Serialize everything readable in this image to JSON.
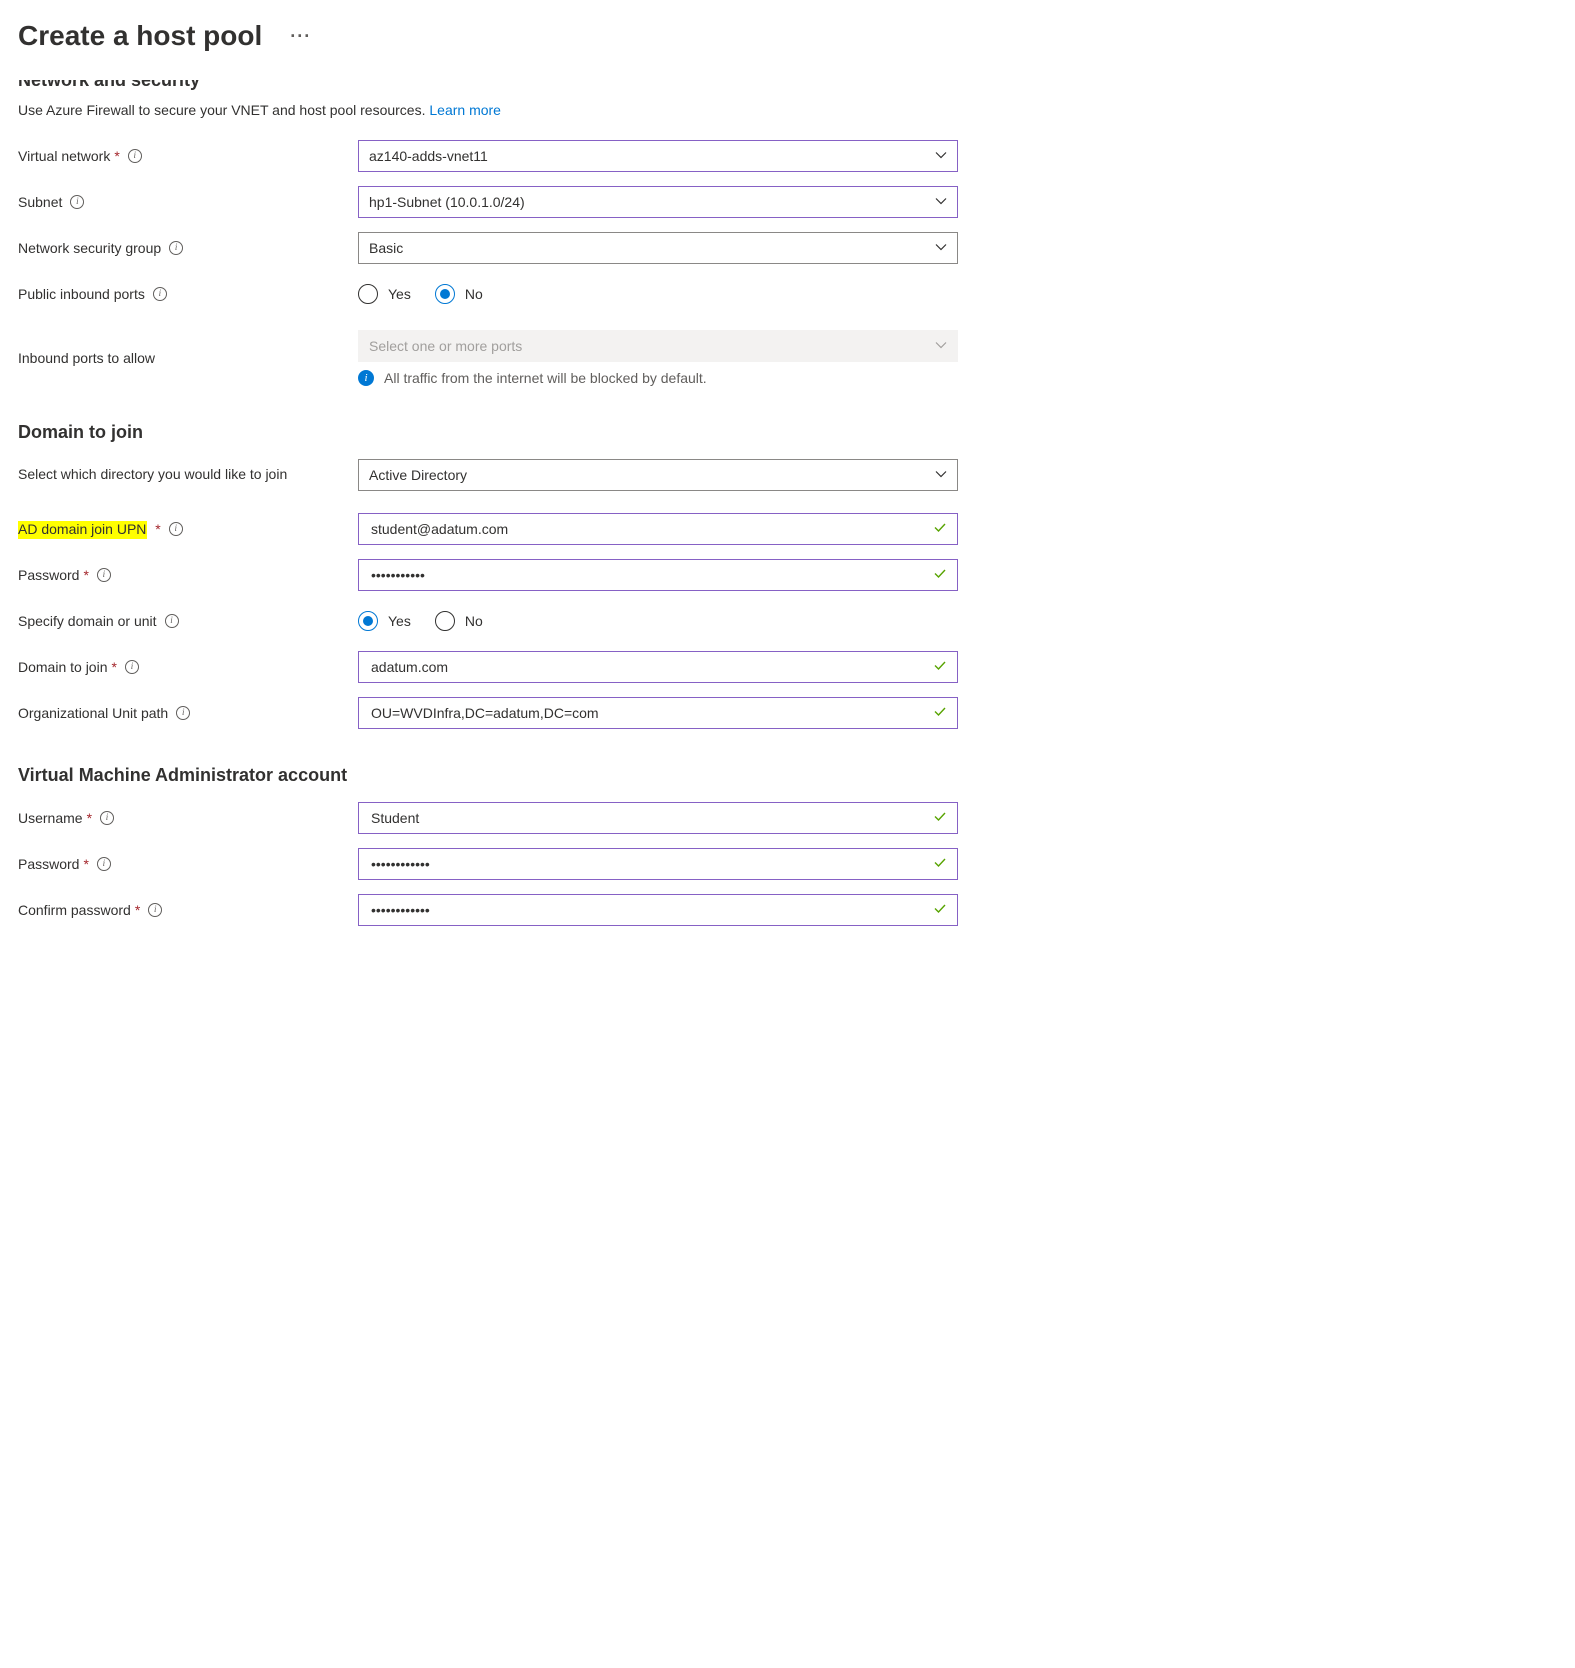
{
  "page": {
    "title": "Create a host pool",
    "cutoff_heading": "Network and security",
    "desc_prefix": "Use Azure Firewall to secure your VNET and host pool resources. ",
    "learn_more": "Learn more"
  },
  "network": {
    "vnet_label": "Virtual network",
    "vnet_value": "az140-adds-vnet11",
    "subnet_label": "Subnet",
    "subnet_value": "hp1-Subnet (10.0.1.0/24)",
    "nsg_label": "Network security group",
    "nsg_value": "Basic",
    "pip_label": "Public inbound ports",
    "pip_yes": "Yes",
    "pip_no": "No",
    "inbound_label": "Inbound ports to allow",
    "inbound_placeholder": "Select one or more ports",
    "inbound_info": "All traffic from the internet will be blocked by default."
  },
  "domain": {
    "heading": "Domain to join",
    "dir_label": "Select which directory you would like to join",
    "dir_value": "Active Directory",
    "upn_label": "AD domain join UPN",
    "upn_value": "student@adatum.com",
    "pw_label": "Password",
    "pw_value": "•••••••••••",
    "spec_label": "Specify domain or unit",
    "spec_yes": "Yes",
    "spec_no": "No",
    "djoin_label": "Domain to join",
    "djoin_value": "adatum.com",
    "ou_label": "Organizational Unit path",
    "ou_value": "OU=WVDInfra,DC=adatum,DC=com"
  },
  "vmadmin": {
    "heading": "Virtual Machine Administrator account",
    "user_label": "Username",
    "user_value": "Student",
    "pw_label": "Password",
    "pw_value": "••••••••••••",
    "cpw_label": "Confirm password",
    "cpw_value": "••••••••••••"
  }
}
